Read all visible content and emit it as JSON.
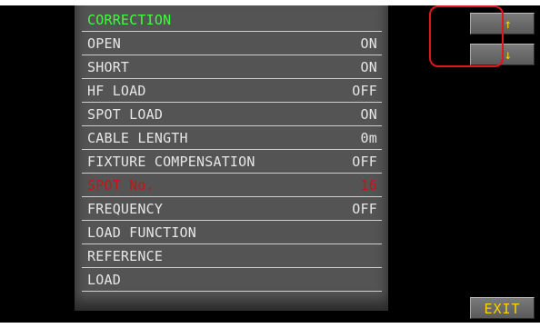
{
  "title": "CORRECTION",
  "rows": [
    {
      "label": "OPEN",
      "value": "ON"
    },
    {
      "label": "SHORT",
      "value": "ON"
    },
    {
      "label": "HF LOAD",
      "value": "OFF"
    },
    {
      "label": "SPOT LOAD",
      "value": "ON"
    },
    {
      "label": "CABLE LENGTH",
      "value": "0m"
    },
    {
      "label": "FIXTURE COMPENSATION",
      "value": "OFF"
    },
    {
      "label": "SPOT No.",
      "value": "16"
    },
    {
      "label": "FREQUENCY",
      "value": "OFF"
    },
    {
      "label": "LOAD FUNCTION",
      "value": ""
    },
    {
      "label": "REFERENCE",
      "value": ""
    },
    {
      "label": "LOAD",
      "value": ""
    }
  ],
  "buttons": {
    "up": "↑",
    "down": "↓",
    "exit": "EXIT"
  },
  "colors": {
    "background": "#000000",
    "panel": "#545454",
    "title": "#3cff3c",
    "selected": "#c81414",
    "button_text": "#ffd200",
    "highlight": "#e1161e"
  },
  "icons": {
    "up": "arrow-up-icon",
    "down": "arrow-down-icon"
  }
}
